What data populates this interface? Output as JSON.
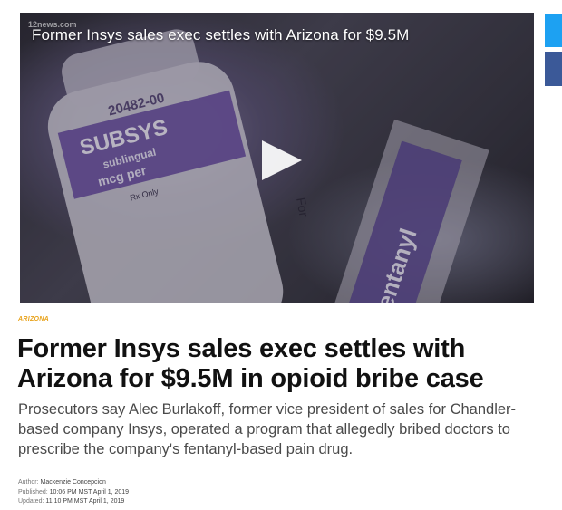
{
  "video": {
    "title": "Former Insys sales exec settles with Arizona for $9.5M",
    "watermark": "12news.com",
    "label_code": "20482-00",
    "label_brand": "SUBSYS",
    "label_line1": "sublingual",
    "label_line2": "mcg per",
    "label_rx": "Rx Only",
    "label_fentanyl": "fentanyl",
    "label_for": "For",
    "play_icon": "play-icon"
  },
  "social": {
    "twitter_icon": "twitter-icon",
    "facebook_icon": "facebook-icon"
  },
  "article": {
    "category": "ARIZONA",
    "headline": "Former Insys sales exec settles with Arizona for $9.5M in opioid bribe case",
    "summary": "Prosecutors say Alec Burlakoff, former vice president of sales for Chandler-based company Insys, operated a program that allegedly bribed doctors to prescribe the company's fentanyl-based pain drug.",
    "author_label": "Author:",
    "author": "Mackenzie Concepcion",
    "published_label": "Published:",
    "published": "10:06 PM MST April 1, 2019",
    "updated_label": "Updated:",
    "updated": "11:10 PM MST April 1, 2019"
  },
  "colors": {
    "category": "#e8a21a",
    "twitter": "#1da1f2",
    "facebook": "#3b5998"
  }
}
